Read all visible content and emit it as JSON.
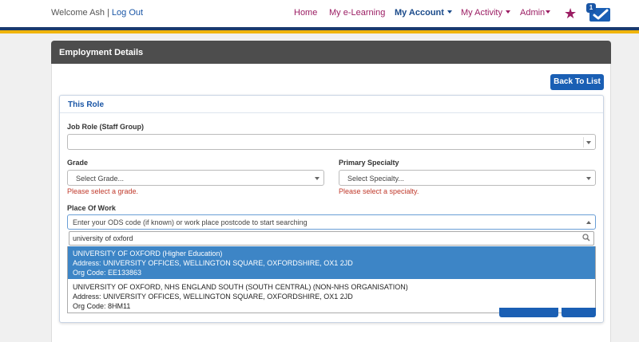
{
  "header": {
    "welcome": "Welcome Ash",
    "separator": "|",
    "logout": "Log Out",
    "nav": {
      "home": "Home",
      "elearning": "My e-Learning",
      "account": "My Account",
      "activity": "My Activity",
      "admin": "Admin"
    },
    "inbox_count": "1"
  },
  "panel": {
    "title": "Employment Details",
    "back_button": "Back To List"
  },
  "role": {
    "title": "This Role",
    "job_role_label": "Job Role (Staff Group)",
    "job_role_value": "",
    "grade_label": "Grade",
    "grade_placeholder": "Select Grade...",
    "grade_error": "Please select a grade.",
    "specialty_label": "Primary Specialty",
    "specialty_placeholder": "Select Specialty...",
    "specialty_error": "Please select a specialty.",
    "place_label": "Place Of Work",
    "place_placeholder": "Enter your ODS code (if known) or work place postcode to start searching",
    "search_value": "university of oxford",
    "results": [
      {
        "name": "UNIVERSITY OF OXFORD (Higher Education)",
        "address": "Address: UNIVERSITY OFFICES, WELLINGTON SQUARE, OXFORDSHIRE, OX1 2JD",
        "code": "Org Code: EE133863"
      },
      {
        "name": "UNIVERSITY OF OXFORD, NHS ENGLAND SOUTH (SOUTH CENTRAL) (NON-NHS ORGANISATION)",
        "address": "Address: UNIVERSITY OFFICES, WELLINGTON SQUARE, OXFORDSHIRE, OX1 2JD",
        "code": "Org Code: 8HM11"
      }
    ]
  },
  "colors": {
    "primary": "#1a5fb4",
    "brand_magenta": "#9b1d63",
    "header_bar": "#4d4d4d",
    "stripe_gold": "#f0b40a",
    "selected_row": "#3d85c6",
    "error": "#c0392b"
  },
  "icons": {
    "favourites": "star-icon",
    "inbox": "inbox-check-icon",
    "search": "magnifier-icon"
  }
}
